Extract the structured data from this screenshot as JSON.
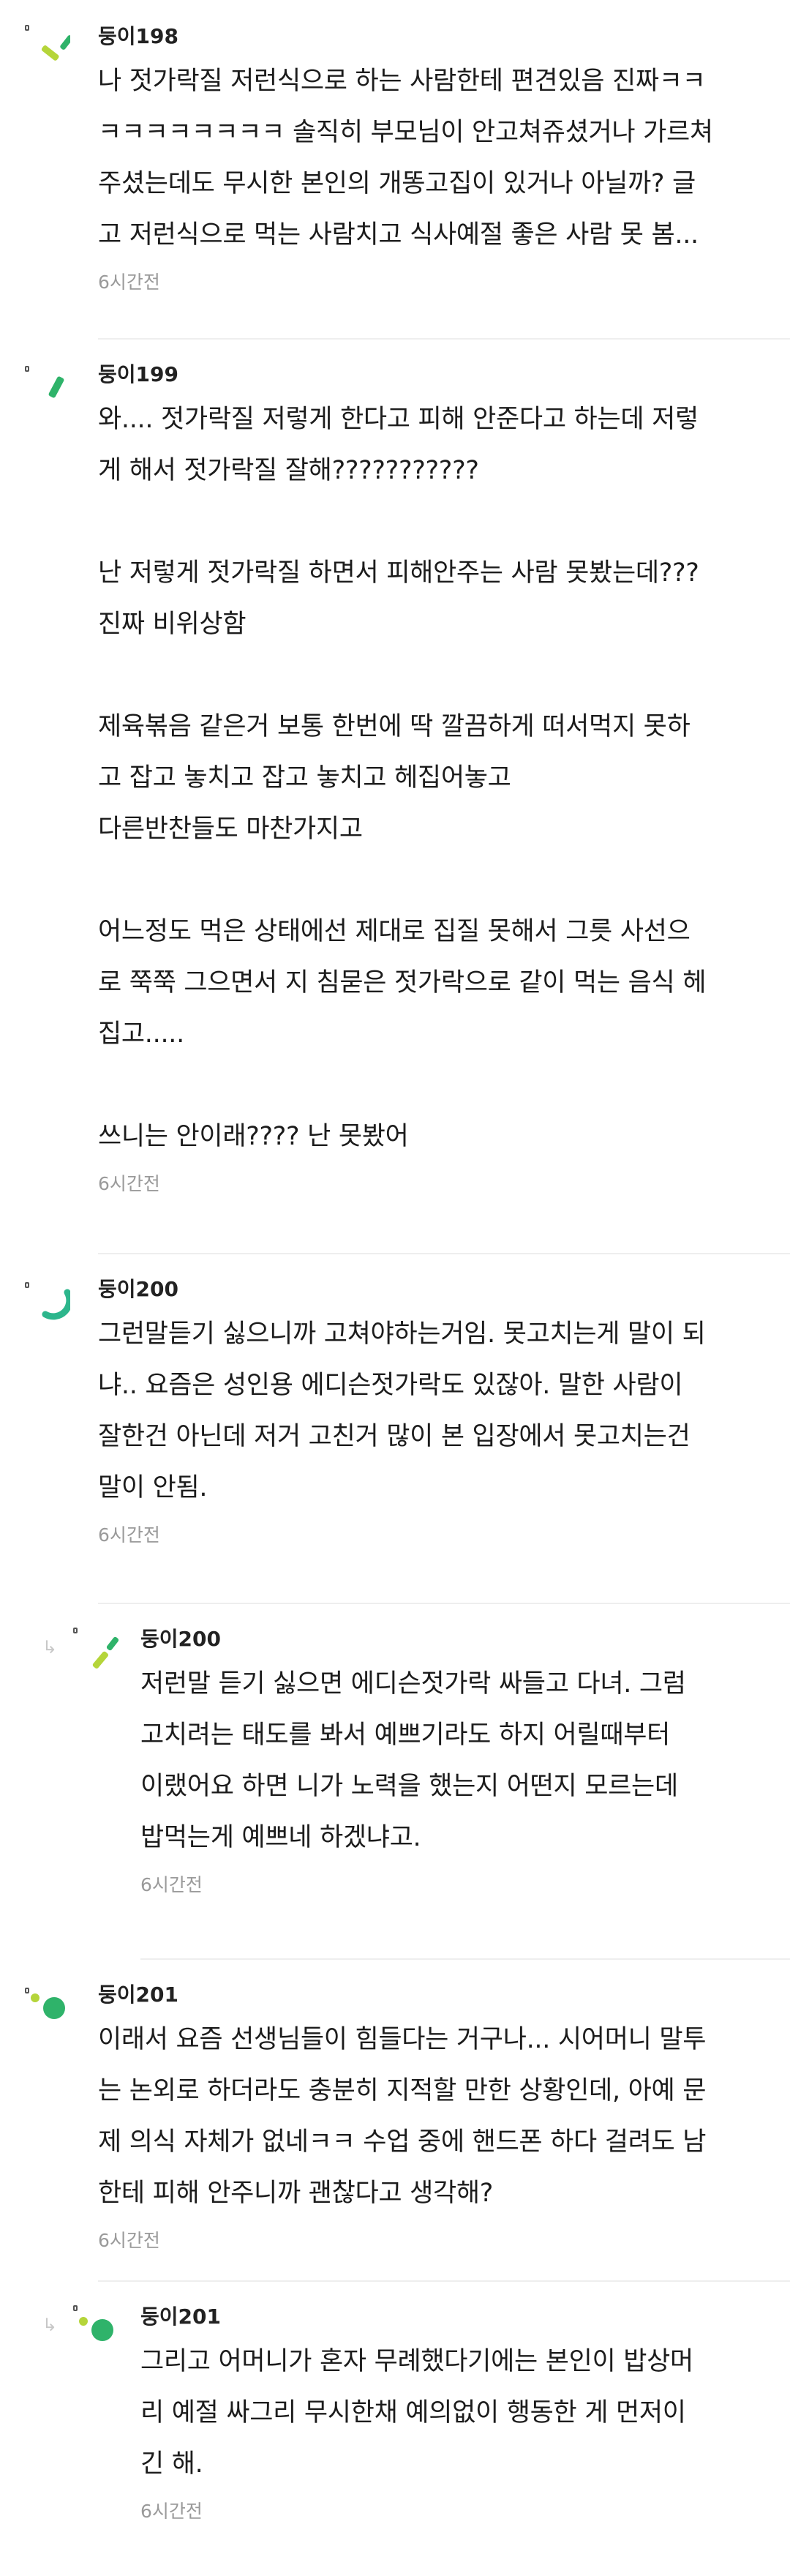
{
  "comments": [
    {
      "author": "둥이198",
      "lines": [
        "나 젓가락질 저런식으로 하는 사람한테 편견있음 진짜ㅋㅋ",
        "ㅋㅋㅋㅋㅋㅋㅋㅋ 솔직히 부모님이 안고쳐쥬셨거나 가르쳐",
        "주셨는데도 무시한 본인의 개똥고집이 있거나 아닐까? 글",
        "고 저런식으로 먹는 사람치고 식사예절 좋은 사람 못 봄..."
      ],
      "time": "6시간전"
    },
    {
      "author": "둥이199",
      "lines": [
        "와.... 젓가락질 저렇게 한다고 피해 안준다고 하는데 저렇",
        "게 해서 젓가락질 잘해???????????",
        "",
        "난 저렇게 젓가락질 하면서 피해안주는 사람 못봤는데???",
        "진짜 비위상함",
        "",
        "제육볶음 같은거 보통 한번에 딱 깔끔하게 떠서먹지 못하",
        "고 잡고 놓치고 잡고 놓치고 헤집어놓고",
        "다른반찬들도 마찬가지고",
        "",
        "어느정도 먹은 상태에선 제대로 집질 못해서 그릇 사선으",
        "로 쭉쭉 그으면서 지 침묻은 젓가락으로 같이 먹는 음식 헤",
        "집고.....",
        "",
        "쓰니는 안이래???? 난 못봤어"
      ],
      "time": "6시간전"
    },
    {
      "author": "둥이200",
      "lines": [
        "그런말듣기 싫으니까 고쳐야하는거임. 못고치는게 말이 되",
        "냐.. 요즘은 성인용 에디슨젓가락도 있잖아. 말한 사람이",
        "잘한건 아닌데 저거 고친거 많이 본 입장에서 못고치는건",
        "말이 안됨."
      ],
      "time": "6시간전"
    },
    {
      "author": "둥이200",
      "lines": [
        "저런말 듣기 싫으면 에디슨젓가락 싸들고 다녀. 그럼",
        "고치려는 태도를 봐서 예쁘기라도 하지 어릴때부터",
        "이랬어요 하면 니가 노력을 했는지 어떤지 모르는데",
        "밥먹는게 예쁘네 하겠냐고."
      ],
      "time": "6시간전"
    },
    {
      "author": "둥이201",
      "lines": [
        "이래서 요즘 선생님들이 힘들다는 거구나... 시어머니 말투",
        "는 논외로 하더라도 충분히 지적할 만한 상황인데, 아예 문",
        "제 의식 자체가 없네ㅋㅋ 수업 중에 핸드폰 하다 걸려도 남",
        "한테 피해 안주니까 괜찮다고 생각해?"
      ],
      "time": "6시간전"
    },
    {
      "author": "둥이201",
      "lines": [
        "그리고 어머니가 혼자 무례했다기에는 본인이 밥상머",
        "리 예절 싸그리 무시한채 예의없이 행동한 게 먼저이",
        "긴 해."
      ],
      "time": "6시간전"
    }
  ],
  "colors": {
    "lime": "#b5d53a",
    "green": "#2fb36a",
    "teal": "#2db68c",
    "divider": "#eeeeee",
    "time": "#9a9a9a"
  },
  "icons": {
    "reply": "reply-arrow-icon",
    "avatar": "avatar-icon"
  }
}
